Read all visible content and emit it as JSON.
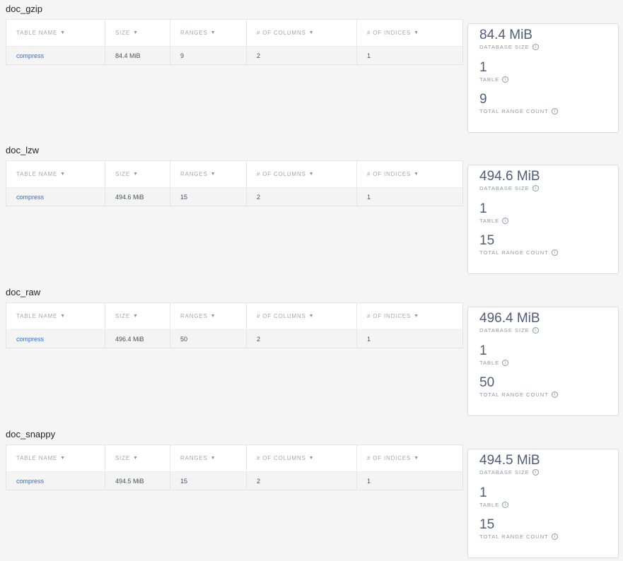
{
  "columns": [
    {
      "label": "TABLE NAME"
    },
    {
      "label": "SIZE"
    },
    {
      "label": "RANGES"
    },
    {
      "label": "# OF COLUMNS"
    },
    {
      "label": "# OF INDICES"
    }
  ],
  "summary_labels": {
    "database_size": "DATABASE SIZE",
    "table": "TABLE",
    "total_range_count": "TOTAL RANGE COUNT"
  },
  "databases": [
    {
      "name": "doc_gzip",
      "rows": [
        {
          "table_name": "compress",
          "size": "84.4 MiB",
          "ranges": "9",
          "columns": "2",
          "indices": "1"
        }
      ],
      "summary": {
        "database_size": "84.4 MiB",
        "table_count": "1",
        "total_range_count": "9"
      }
    },
    {
      "name": "doc_lzw",
      "rows": [
        {
          "table_name": "compress",
          "size": "494.6 MiB",
          "ranges": "15",
          "columns": "2",
          "indices": "1"
        }
      ],
      "summary": {
        "database_size": "494.6 MiB",
        "table_count": "1",
        "total_range_count": "15"
      }
    },
    {
      "name": "doc_raw",
      "rows": [
        {
          "table_name": "compress",
          "size": "496.4 MiB",
          "ranges": "50",
          "columns": "2",
          "indices": "1"
        }
      ],
      "summary": {
        "database_size": "496.4 MiB",
        "table_count": "1",
        "total_range_count": "50"
      }
    },
    {
      "name": "doc_snappy",
      "rows": [
        {
          "table_name": "compress",
          "size": "494.5 MiB",
          "ranges": "15",
          "columns": "2",
          "indices": "1"
        }
      ],
      "summary": {
        "database_size": "494.5 MiB",
        "table_count": "1",
        "total_range_count": "15"
      }
    }
  ]
}
